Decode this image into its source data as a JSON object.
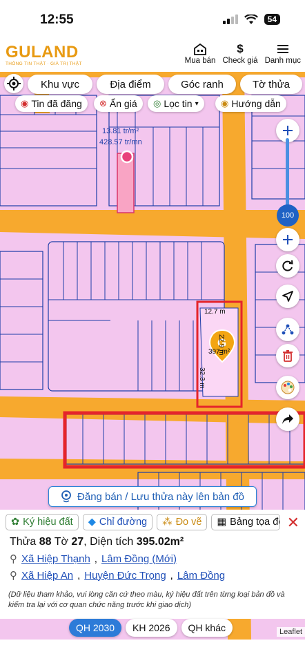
{
  "status": {
    "time": "12:55",
    "battery": "54"
  },
  "header": {
    "logo": "GULAND",
    "tagline": "THÔNG TIN THẬT · GIÁ TRỊ THẬT",
    "actions": [
      {
        "label": "Mua bán",
        "icon": "house-icon"
      },
      {
        "label": "Check giá",
        "icon": "dollar-icon"
      },
      {
        "label": "Danh mục",
        "icon": "menu-icon"
      }
    ]
  },
  "search_tabs": [
    "Khu vực",
    "Địa điểm",
    "Góc ranh",
    "Tờ thửa"
  ],
  "filter_chips": [
    {
      "label": "Tin đã đăng",
      "icon": "eye-icon"
    },
    {
      "label": "Ẩn giá",
      "icon": "hide-price-icon"
    },
    {
      "label": "Lọc tin",
      "icon": "location-filter-icon"
    },
    {
      "label": "Hướng dẫn",
      "icon": "guide-icon"
    }
  ],
  "map": {
    "zoom": "100",
    "price_label_1": "13.81 tr/m²",
    "price_label_2": "428.57 tr/mn",
    "dim_top": "12.7 m",
    "dim_right": "22.9 m",
    "dim_left": "32.3 m",
    "area_label": "397 m²",
    "attribution": "Leaflet"
  },
  "post_banner": "Đăng bán / Lưu thửa này lên bản đồ",
  "tools": [
    {
      "label": "Ký hiệu đất",
      "icon": "palette-icon"
    },
    {
      "label": "Chỉ đường",
      "icon": "directions-icon"
    },
    {
      "label": "Đo vẽ",
      "icon": "measure-icon"
    },
    {
      "label": "Bảng tọa độ",
      "icon": "table-icon"
    }
  ],
  "lot": {
    "prefix": "Thửa",
    "parcel": "88",
    "sheet_label": "Tờ",
    "sheet": "27",
    "area_label": "Diện tích",
    "area": "395.02m²",
    "address_1_ward": "Xã Hiệp Thạnh",
    "address_1_province": "Lâm Đồng (Mới)",
    "address_2_ward": "Xã Hiệp An",
    "address_2_district": "Huyện Đức Trọng",
    "address_2_province": "Lâm Đồng",
    "note": "(Dữ liệu tham khảo, vui lòng căn cứ theo màu, ký hiệu đất trên từng loại bản đồ và kiểm tra lại với cơ quan chức năng trước khi giao dịch)"
  },
  "plan_tabs": [
    "QH 2030",
    "KH 2026",
    "QH khác"
  ]
}
